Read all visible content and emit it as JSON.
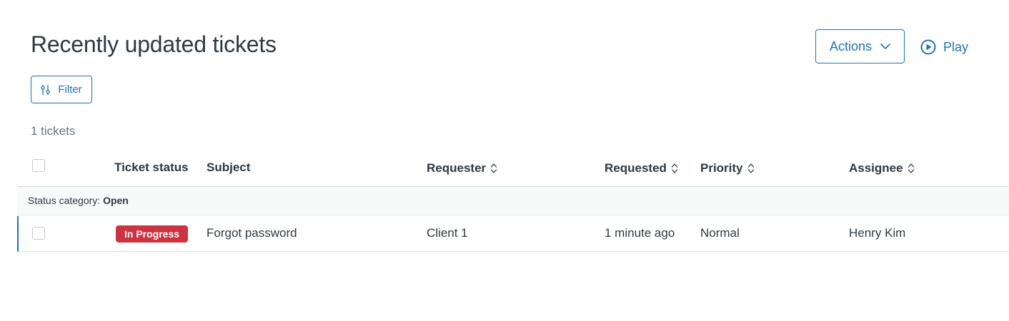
{
  "page": {
    "title": "Recently updated tickets",
    "count_text": "1 tickets"
  },
  "toolbar": {
    "actions_label": "Actions",
    "play_label": "Play",
    "filter_label": "Filter"
  },
  "table": {
    "headers": {
      "status": "Ticket status",
      "subject": "Subject",
      "requester": "Requester",
      "requested": "Requested",
      "priority": "Priority",
      "assignee": "Assignee"
    },
    "group": {
      "prefix": "Status category: ",
      "value": "Open"
    },
    "rows": [
      {
        "status": "In Progress",
        "subject": "Forgot password",
        "requester": "Client 1",
        "requested": "1 minute ago",
        "priority": "Normal",
        "assignee": "Henry Kim"
      }
    ]
  },
  "colors": {
    "accent": "#1f73b7",
    "status_in_progress": "#cc3340",
    "text": "#2f3941"
  },
  "icons": {
    "actions": "chevron-down-icon",
    "play": "play-circle-icon",
    "filter": "sliders-icon",
    "sort": "sort-icon"
  }
}
